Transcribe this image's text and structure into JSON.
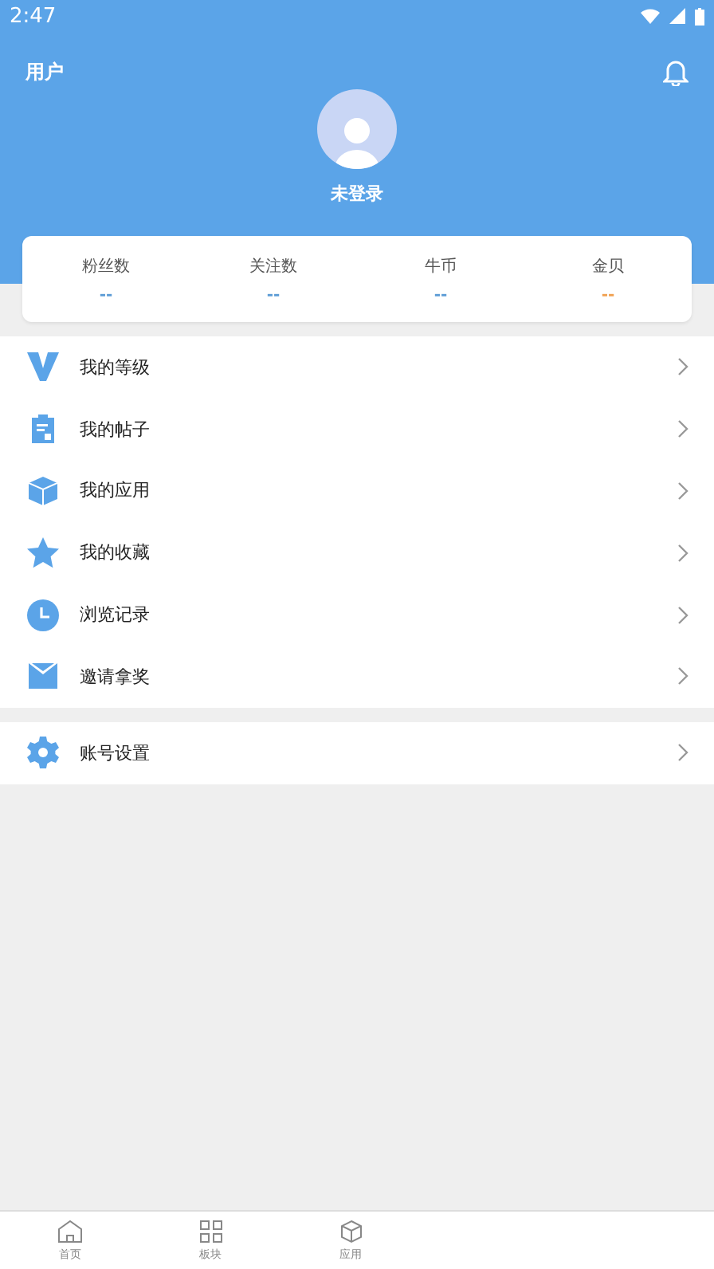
{
  "status_bar": {
    "time": "2:47"
  },
  "header": {
    "title": "用户",
    "username": "未登录"
  },
  "stats": [
    {
      "label": "粉丝数",
      "value": "--",
      "color": "#5b9bd5"
    },
    {
      "label": "关注数",
      "value": "--",
      "color": "#5b9bd5"
    },
    {
      "label": "牛币",
      "value": "--",
      "color": "#5b9bd5"
    },
    {
      "label": "金贝",
      "value": "--",
      "color": "#f0a050"
    }
  ],
  "menu_groups": [
    [
      {
        "kind": "level",
        "label": "我的等级"
      },
      {
        "kind": "posts",
        "label": "我的帖子"
      },
      {
        "kind": "apps",
        "label": "我的应用"
      },
      {
        "kind": "favorites",
        "label": "我的收藏"
      },
      {
        "kind": "history",
        "label": "浏览记录"
      },
      {
        "kind": "invite",
        "label": "邀请拿奖"
      }
    ],
    [
      {
        "kind": "settings",
        "label": "账号设置"
      }
    ]
  ],
  "bottom_nav": [
    {
      "kind": "home",
      "label": "首页",
      "selected": false
    },
    {
      "kind": "boards",
      "label": "板块",
      "selected": false
    },
    {
      "kind": "apps",
      "label": "应用",
      "selected": false
    }
  ]
}
